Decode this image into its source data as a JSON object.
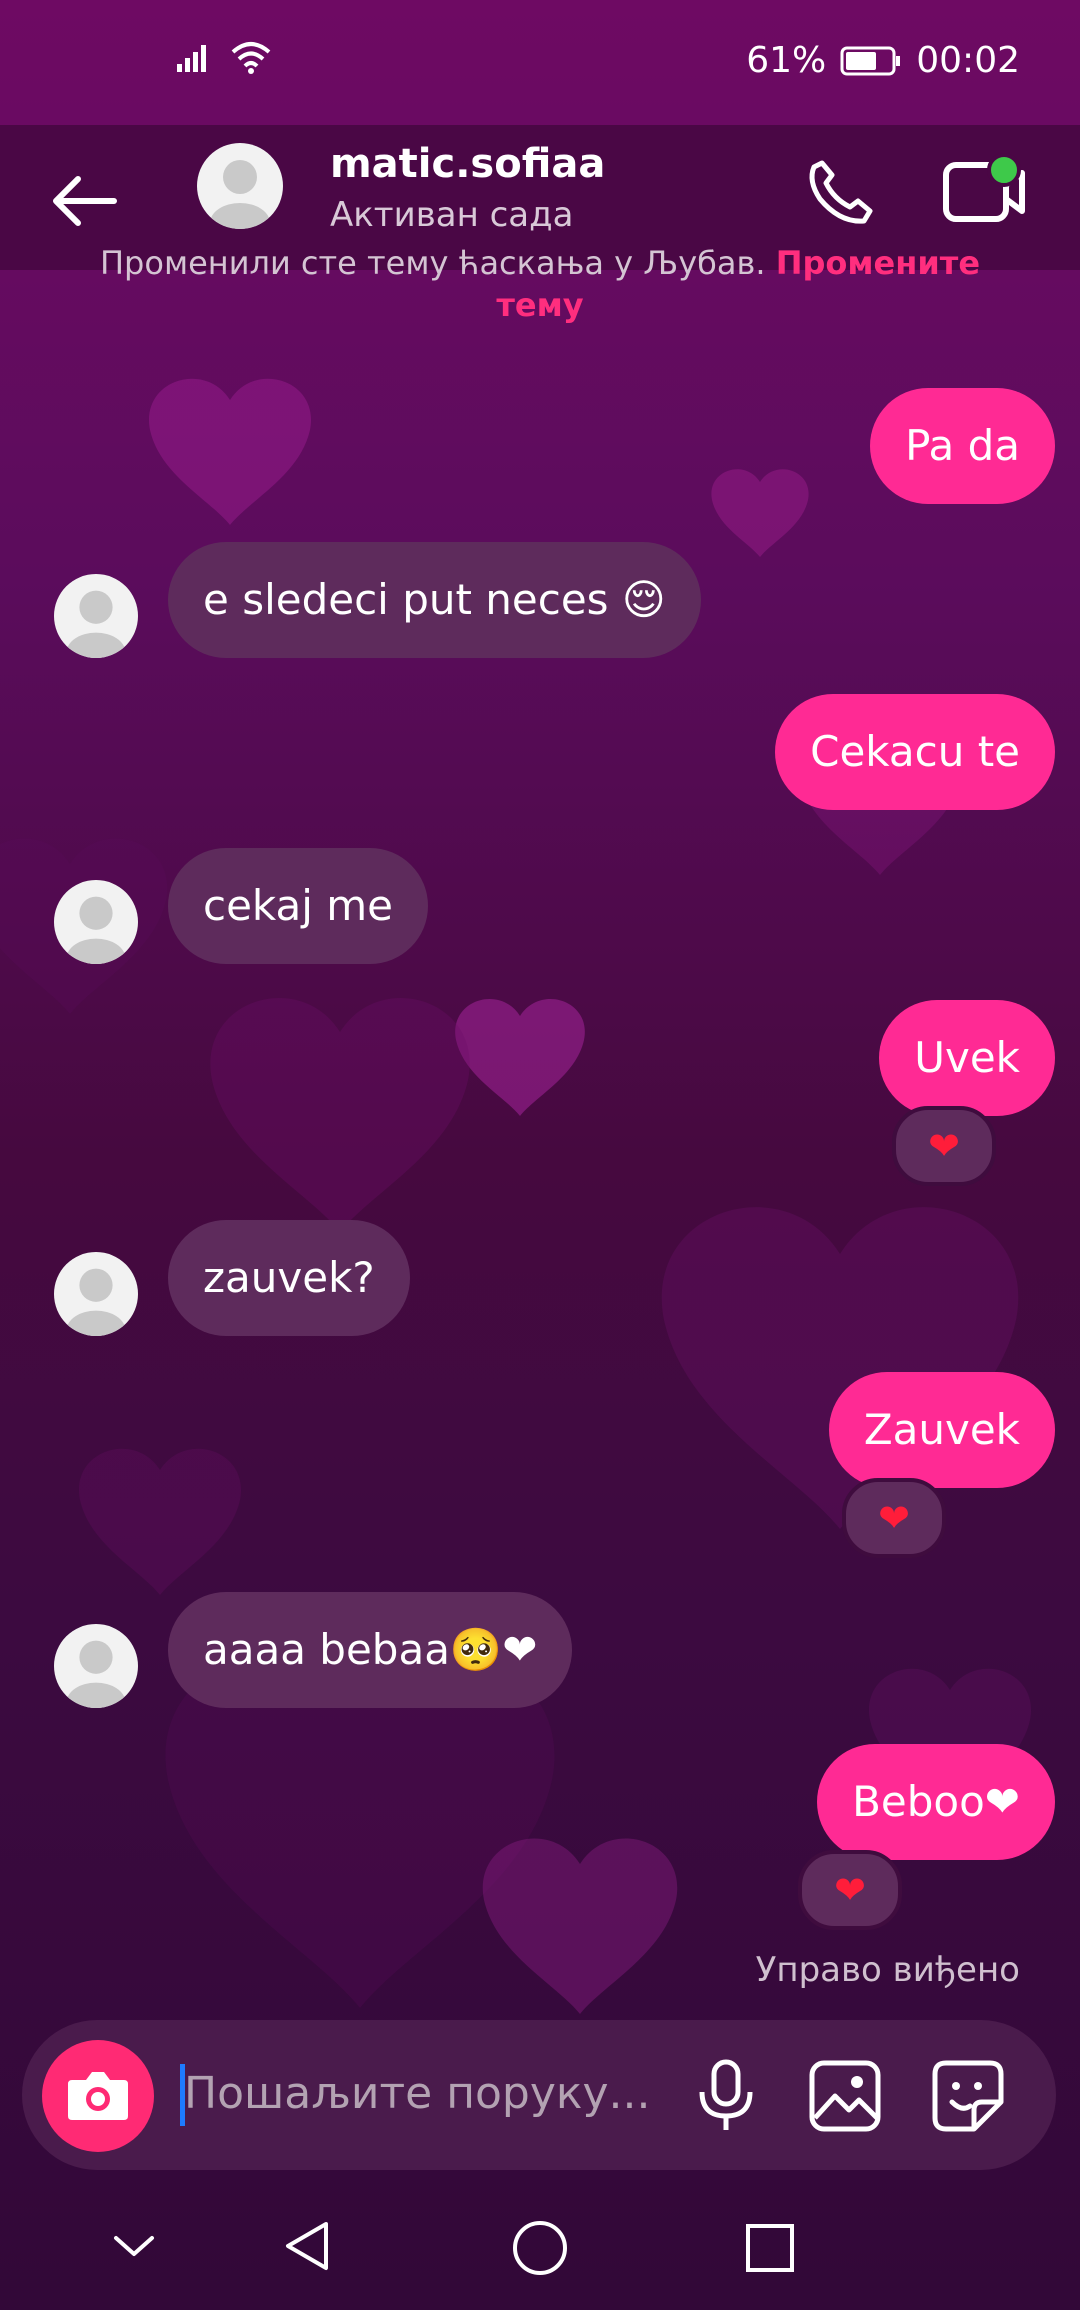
{
  "status_bar": {
    "battery": "61%",
    "time": "00:02"
  },
  "header": {
    "username": "matic.sofiaa",
    "activity": "Активан сада"
  },
  "theme_note": {
    "text": "Променили сте тему ћаскања у Љубав.",
    "link": "Промените тему"
  },
  "messages": [
    {
      "direction": "out",
      "text": "Pa da"
    },
    {
      "direction": "in",
      "text": "e sledeci put neces 😌"
    },
    {
      "direction": "out",
      "text": "Cekacu te"
    },
    {
      "direction": "in",
      "text": "cekaj me"
    },
    {
      "direction": "out",
      "text": "Uvek",
      "reaction": "❤"
    },
    {
      "direction": "in",
      "text": "zauvek?"
    },
    {
      "direction": "out",
      "text": "Zauvek",
      "reaction": "❤"
    },
    {
      "direction": "in",
      "text": "aaaa bebaa🥺❤"
    },
    {
      "direction": "out",
      "text": "Beboo❤",
      "reaction": "❤"
    }
  ],
  "seen_label": "Управо виђено",
  "composer": {
    "placeholder": "Пошаљите поруку..."
  },
  "icons": {
    "status": [
      "signal-icon",
      "wifi-icon",
      "battery-icon"
    ],
    "header": [
      "back-arrow-icon",
      "phone-icon",
      "video-call-icon"
    ],
    "composer": [
      "camera-icon",
      "microphone-icon",
      "gallery-icon",
      "sticker-icon"
    ],
    "navigation": [
      "chevron-down-icon",
      "back-triangle-icon",
      "home-circle-icon",
      "recents-square-icon"
    ]
  },
  "colors": {
    "outgoing_bubble": "#ff2a94",
    "incoming_bubble": "#5e2b5c",
    "accent": "#ff2e7e",
    "online": "#3ec94a"
  }
}
